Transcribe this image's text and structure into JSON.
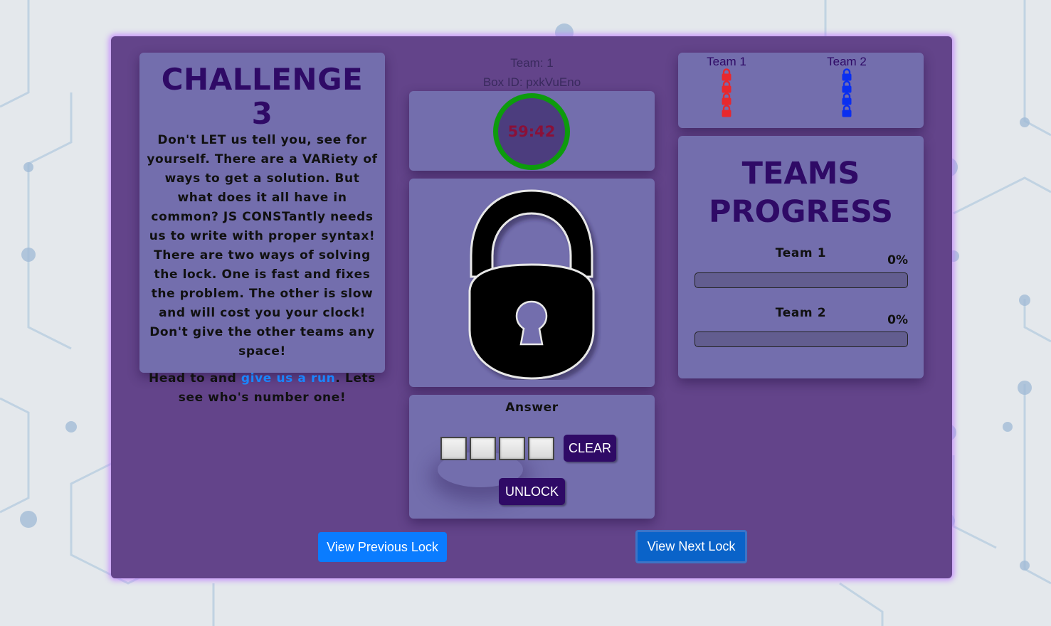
{
  "challenge": {
    "title": "CHALLENGE 3",
    "body": "Don't LET us tell you, see for yourself. There are a VARiety of ways to get a solution. But what does it all have in common? JS CONSTantly needs us to write with proper syntax! There are two ways of solving the lock. One is fast and fixes the problem. The other is slow and will cost you your clock! Don't give the other teams any space!",
    "cta_before": "Head to and ",
    "cta_link": "give us a run",
    "cta_after": ". Lets see who's number one!"
  },
  "info": {
    "team": "Team: 1",
    "box_id": "Box ID: pxkVuEno"
  },
  "timer": {
    "value": "59:42"
  },
  "answer": {
    "label": "Answer",
    "clear_label": "CLEAR",
    "unlock_label": "UNLOCK"
  },
  "teams": [
    {
      "name": "Team 1",
      "lock_count": 4,
      "color": "#e8282d"
    },
    {
      "name": "Team 2",
      "lock_count": 4,
      "color": "#0a2ff0"
    }
  ],
  "progress": {
    "title_line1": "TEAMS",
    "title_line2": "PROGRESS",
    "teams": [
      {
        "name": "Team 1",
        "percent_label": "0%",
        "percent": 0
      },
      {
        "name": "Team 2",
        "percent_label": "0%",
        "percent": 0
      }
    ]
  },
  "nav": {
    "prev_label": "View Previous Lock",
    "next_label": "View Next Lock"
  },
  "colors": {
    "panel": "#63448a",
    "card": "#736ead",
    "accent": "#2f0a66",
    "timer_ring": "#0d9b0d",
    "link": "#1a86ff",
    "button_blue": "#0a7cff"
  },
  "icons": {
    "main_lock": "padlock-icon",
    "team_lock": "padlock-icon"
  }
}
